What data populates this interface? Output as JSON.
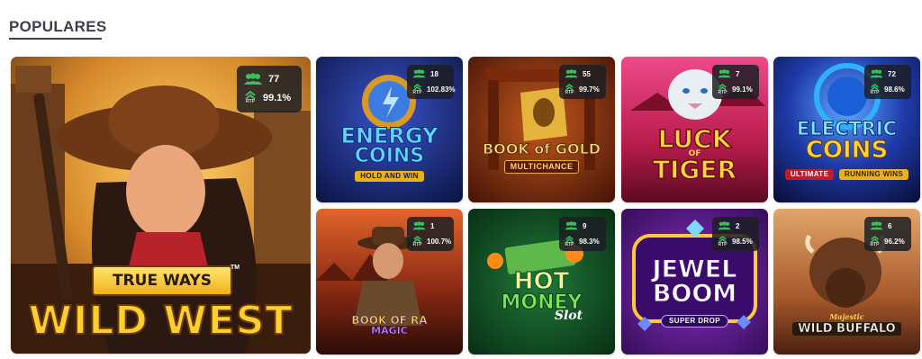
{
  "section": {
    "title": "POPULARES"
  },
  "labels": {
    "rtp": "RTP"
  },
  "colors": {
    "players_icon": "#38c15b",
    "rtp_icon": "#38c15b",
    "stats_bg": "#1c1e24",
    "heading": "#3b3f4a"
  },
  "games": [
    {
      "id": "wild-west",
      "badge": "TRUE WAYS",
      "title": "WILD WEST",
      "players": "77",
      "rtp": "99.1%"
    },
    {
      "id": "energy-coins",
      "title_line1": "ENERGY",
      "title_line2": "COINS",
      "subtitle": "HOLD AND WIN",
      "players": "18",
      "rtp": "102.83%"
    },
    {
      "id": "book-of-gold",
      "title_line1": "BOOK of GOLD",
      "subtitle": "MULTICHANCE",
      "players": "55",
      "rtp": "99.7%"
    },
    {
      "id": "luck-of-tiger",
      "title_line1": "LUCK",
      "title_small": "OF",
      "title_line2": "TIGER",
      "players": "7",
      "rtp": "99.1%"
    },
    {
      "id": "electric-coins",
      "title_line1": "ELECTRIC",
      "title_line2": "COINS",
      "subtitle": "ULTIMATE",
      "subtitle2": "RUNNING WINS",
      "players": "72",
      "rtp": "98.6%"
    },
    {
      "id": "book-of-ra-magic",
      "title_line1": "BOOK OF RA",
      "title_line2": "MAGIC",
      "players": "1",
      "rtp": "100.7%"
    },
    {
      "id": "hot-money",
      "title_line1": "HOT",
      "title_line2": "MONEY",
      "title_script": "Slot",
      "players": "9",
      "rtp": "98.3%"
    },
    {
      "id": "jewel-boom",
      "title_line1": "JEWEL",
      "title_line2": "BOOM",
      "subtitle": "SUPER DROP",
      "players": "2",
      "rtp": "98.5%"
    },
    {
      "id": "wild-buffalo",
      "title_small": "Majestic",
      "title_line1": "WILD BUFFALO",
      "players": "6",
      "rtp": "96.2%"
    }
  ]
}
